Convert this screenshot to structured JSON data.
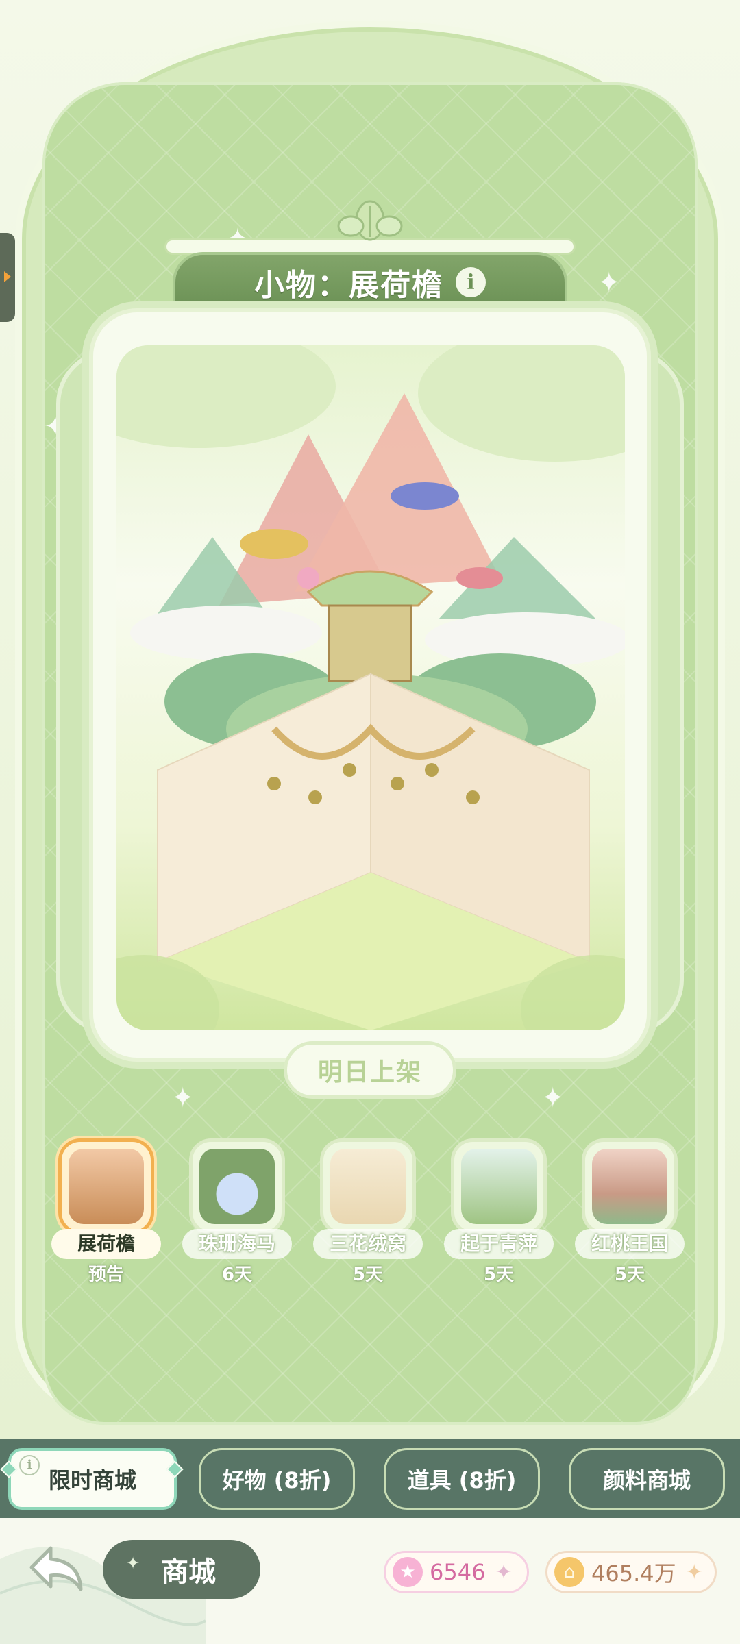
{
  "title": {
    "text": "小物：展荷檐",
    "info_icon": "info-icon"
  },
  "status_pill": "明日上架",
  "items": [
    {
      "name": "展荷檐",
      "sub": "预告",
      "active": true,
      "color": "#c98d58"
    },
    {
      "name": "珠珊海马",
      "sub": "6天",
      "active": false,
      "color": "#7fa36a"
    },
    {
      "name": "三花绒窝",
      "sub": "5天",
      "active": false,
      "color": "#e9d7b1"
    },
    {
      "name": "起于青萍",
      "sub": "5天",
      "active": false,
      "color": "#9fc483"
    },
    {
      "name": "红桃王国",
      "sub": "5天",
      "active": false,
      "color": "#c99a86"
    }
  ],
  "tabs": [
    {
      "label": "限时商城",
      "active": true
    },
    {
      "label": "好物 (8折)",
      "active": false
    },
    {
      "label": "道具 (8折)",
      "active": false
    },
    {
      "label": "颜料商城",
      "active": false
    }
  ],
  "bottom": {
    "back_icon": "back-arrow-icon",
    "shop_label": "商城"
  },
  "currencies": {
    "star": {
      "value": "6546",
      "icon": "star-icon"
    },
    "coin": {
      "value": "465.4万",
      "icon": "coin-icon"
    }
  },
  "colors": {
    "accent_green": "#6b9155",
    "tab_bar": "#587566",
    "active_item_border": "#f2b04f"
  }
}
